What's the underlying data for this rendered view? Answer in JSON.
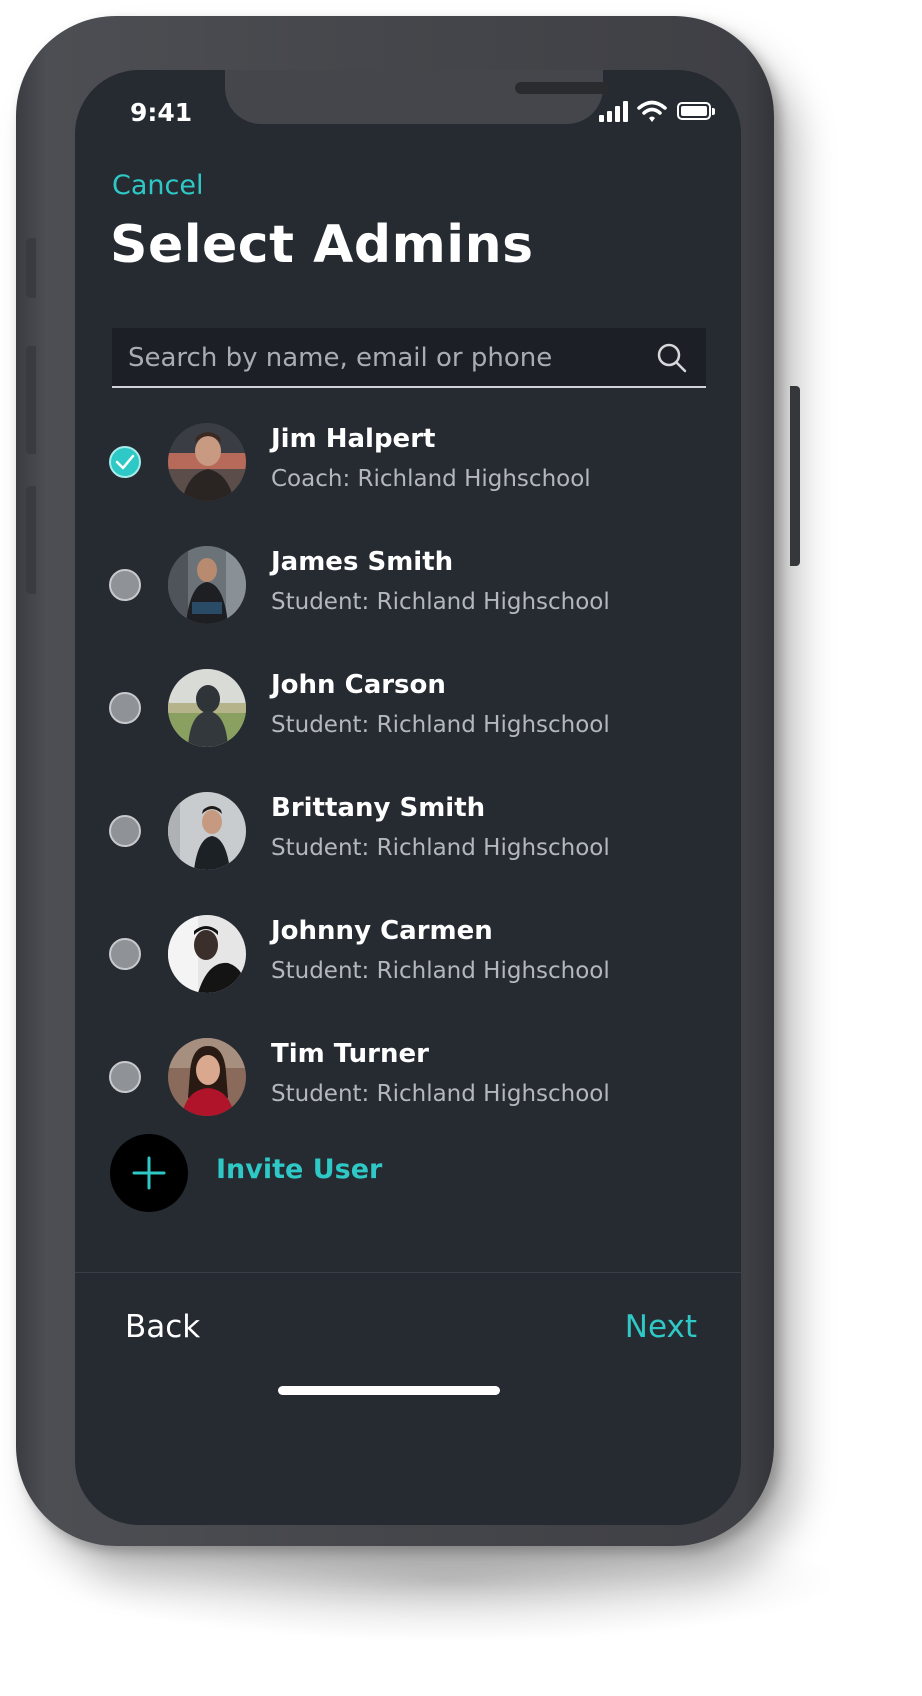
{
  "status_bar": {
    "time": "9:41"
  },
  "header": {
    "cancel_label": "Cancel",
    "title": "Select Admins"
  },
  "search": {
    "placeholder": "Search by name, email or phone",
    "value": ""
  },
  "users": [
    {
      "name": "Jim Halpert",
      "role": "Coach: Richland Highschool",
      "selected": true
    },
    {
      "name": "James Smith",
      "role": "Student: Richland Highschool",
      "selected": false
    },
    {
      "name": "John Carson",
      "role": "Student: Richland Highschool",
      "selected": false
    },
    {
      "name": "Brittany Smith",
      "role": "Student: Richland Highschool",
      "selected": false
    },
    {
      "name": "Johnny Carmen",
      "role": "Student: Richland Highschool",
      "selected": false
    },
    {
      "name": "Tim Turner",
      "role": "Student: Richland Highschool",
      "selected": false
    }
  ],
  "invite": {
    "label": "Invite User"
  },
  "footer": {
    "back_label": "Back",
    "next_label": "Next"
  },
  "colors": {
    "accent": "#2ec9c6",
    "background": "#262a31",
    "radio_unchecked": "#8f9297"
  }
}
